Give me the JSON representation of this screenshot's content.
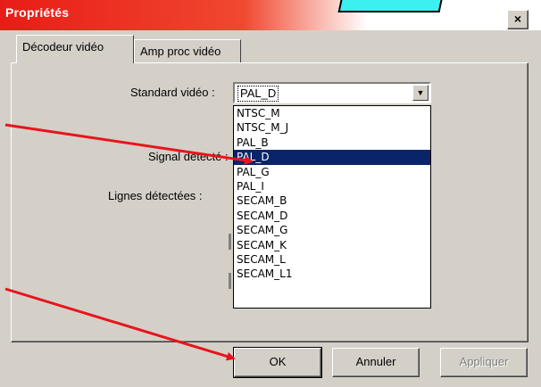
{
  "window": {
    "title": "Propriétés",
    "close_glyph": "×"
  },
  "tabs": [
    {
      "label": "Décodeur vidéo",
      "active": true
    },
    {
      "label": "Amp proc vidéo",
      "active": false
    }
  ],
  "fields": {
    "standard_label": "Standard vidéo :",
    "standard_value": "PAL_D",
    "signal_label": "Signal détecté :",
    "lines_label": "Lignes détectées :"
  },
  "dropdown": {
    "options": [
      "NTSC_M",
      "NTSC_M_J",
      "PAL_B",
      "PAL_D",
      "PAL_G",
      "PAL_I",
      "SECAM_B",
      "SECAM_D",
      "SECAM_G",
      "SECAM_K",
      "SECAM_L",
      "SECAM_L1"
    ],
    "selected": "PAL_D"
  },
  "buttons": {
    "ok": "OK",
    "cancel": "Annuler",
    "apply": "Appliquer"
  },
  "colors": {
    "title_red": "#e81c16",
    "selection": "#0a246a",
    "arrow_red": "#e8141c",
    "callout_cyan": "#3cf0f0"
  }
}
